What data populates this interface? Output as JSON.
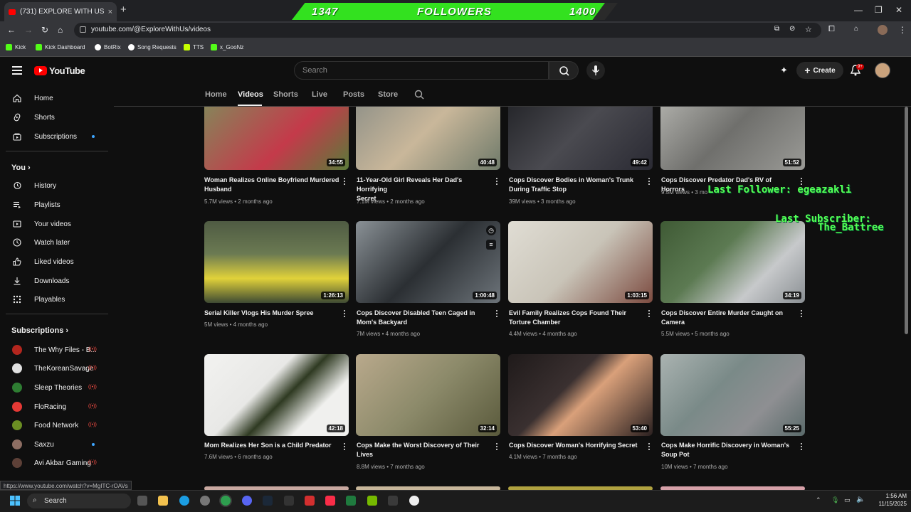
{
  "browser": {
    "tab_title": "(731) EXPLORE WITH US - YouTu",
    "tab_close": "×",
    "new_tab": "+",
    "url": "youtube.com/@ExploreWithUs/videos",
    "bookmarks": [
      {
        "label": "Kick",
        "color": "#53fc18"
      },
      {
        "label": "Kick Dashboard",
        "color": "#53fc18"
      },
      {
        "label": "BotRix",
        "color": "#ffffff"
      },
      {
        "label": "Song Requests",
        "color": "#ffffff"
      },
      {
        "label": "TTS",
        "color": "#c6ff00"
      },
      {
        "label": "x_GooNz",
        "color": "#53fc18"
      }
    ],
    "status_url": "https://www.youtube.com/watch?v=MgITC-rOAVs"
  },
  "follower_goal": {
    "current": "1347",
    "label": "FOLLOWERS",
    "target": "1400",
    "progress": 0.96
  },
  "overlay": {
    "last_follower": "Last Follower: egeazakli",
    "last_subscriber_label": "Last Subscriber:",
    "last_subscriber_name": "The_Battree"
  },
  "youtube": {
    "logo": "YouTube",
    "search_placeholder": "Search",
    "create_label": "Create",
    "notif_count": "9+"
  },
  "sidebar": {
    "main": [
      {
        "label": "Home",
        "icon": "home-icon"
      },
      {
        "label": "Shorts",
        "icon": "shorts-icon"
      },
      {
        "label": "Subscriptions",
        "icon": "subscriptions-icon"
      }
    ],
    "you_header": "You",
    "you_items": [
      {
        "label": "History",
        "icon": "history-icon"
      },
      {
        "label": "Playlists",
        "icon": "playlists-icon"
      },
      {
        "label": "Your videos",
        "icon": "your-videos-icon"
      },
      {
        "label": "Watch later",
        "icon": "watch-later-icon"
      },
      {
        "label": "Liked videos",
        "icon": "liked-videos-icon"
      },
      {
        "label": "Downloads",
        "icon": "downloads-icon"
      },
      {
        "label": "Playables",
        "icon": "playables-icon"
      }
    ],
    "subs_header": "Subscriptions",
    "subscriptions": [
      {
        "label": "The Why Files - B...",
        "status": "live",
        "color": "#b3261e"
      },
      {
        "label": "TheKoreanSavage",
        "status": "live",
        "color": "#e0e0e0"
      },
      {
        "label": "Sleep Theories",
        "status": "live",
        "color": "#2e7d32"
      },
      {
        "label": "FloRacing",
        "status": "live",
        "color": "#e53935"
      },
      {
        "label": "Food Network",
        "status": "live",
        "color": "#6b8e23"
      },
      {
        "label": "Saxzu",
        "status": "new",
        "color": "#8d6e63"
      },
      {
        "label": "Avi Akbar Gaming",
        "status": "live",
        "color": "#5d4037"
      }
    ],
    "live_glyph": "((•))"
  },
  "channel_tabs": [
    "Home",
    "Videos",
    "Shorts",
    "Live",
    "Posts",
    "Store"
  ],
  "videos": [
    {
      "title_l1": "Woman Realizes Online Boyfriend Murdered",
      "title_l2": "Husband",
      "views": "5.7M views",
      "age": "2 months ago",
      "duration": "34:55",
      "color": "#6a7a5a"
    },
    {
      "title_l1": "11-Year-Old Girl Reveals Her Dad's Horrifying",
      "title_l2": "Secret",
      "views": "7.1M views",
      "age": "2 months ago",
      "duration": "40:48",
      "color": "#8a8d86"
    },
    {
      "title_l1": "Cops Discover Bodies in Woman's Trunk",
      "title_l2": "During Traffic Stop",
      "views": "39M views",
      "age": "3 months ago",
      "duration": "49:42",
      "color": "#2a2a33"
    },
    {
      "title_l1": "Cops Discover Predator Dad's RV of Horrors",
      "title_l2": "",
      "views": "9.5M views",
      "age": "3 mo",
      "duration": "51:52",
      "color": "#9a9a96"
    },
    {
      "title_l1": "Serial Killer Vlogs His Murder Spree",
      "title_l2": "",
      "views": "5M views",
      "age": "4 months ago",
      "duration": "1:26:13",
      "color": "#4f5b43"
    },
    {
      "title_l1": "Cops Discover Disabled Teen Caged in",
      "title_l2": "Mom's Backyard",
      "views": "7M views",
      "age": "4 months ago",
      "duration": "1:00:48",
      "color": "#6d747a"
    },
    {
      "title_l1": "Evil Family Realizes Cops Found Their",
      "title_l2": "Torture Chamber",
      "views": "4.4M views",
      "age": "4 months ago",
      "duration": "1:03:15",
      "color": "#c9c4b8"
    },
    {
      "title_l1": "Cops Discover Entire Murder Caught on",
      "title_l2": "Camera",
      "views": "5.5M views",
      "age": "5 months ago",
      "duration": "34:19",
      "color": "#5c7a52"
    },
    {
      "title_l1": "Mom Realizes Her Son is a Child Predator",
      "title_l2": "",
      "views": "7.6M views",
      "age": "6 months ago",
      "duration": "42:18",
      "color": "#e8e8e6"
    },
    {
      "title_l1": "Cops Make the Worst Discovery of Their",
      "title_l2": "Lives",
      "views": "8.8M views",
      "age": "7 months ago",
      "duration": "32:14",
      "color": "#8c8a6a"
    },
    {
      "title_l1": "Cops Discover Woman's Horrifying Secret",
      "title_l2": "",
      "views": "4.1M views",
      "age": "7 months ago",
      "duration": "53:40",
      "color": "#3a3030"
    },
    {
      "title_l1": "Cops Make Horrific Discovery in Woman's",
      "title_l2": "Soup Pot",
      "views": "10M views",
      "age": "7 months ago",
      "duration": "55:25",
      "color": "#7a8a88"
    }
  ],
  "taskbar": {
    "search_label": "Search",
    "time": "1:56 AM",
    "date": "11/15/2025"
  }
}
